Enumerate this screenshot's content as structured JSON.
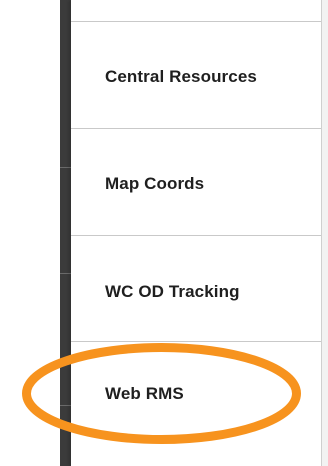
{
  "menu": {
    "items": [
      {
        "label": ""
      },
      {
        "label": "Central Resources"
      },
      {
        "label": "Map Coords"
      },
      {
        "label": "WC OD Tracking"
      },
      {
        "label": "Web RMS"
      }
    ]
  },
  "annotation": {
    "highlight_color": "#F7931E",
    "highlighted_item": "Web RMS"
  },
  "colors": {
    "sidebar_dark": "#3b3b3b",
    "divider": "#c9c9c9",
    "text": "#1f1f1f"
  }
}
